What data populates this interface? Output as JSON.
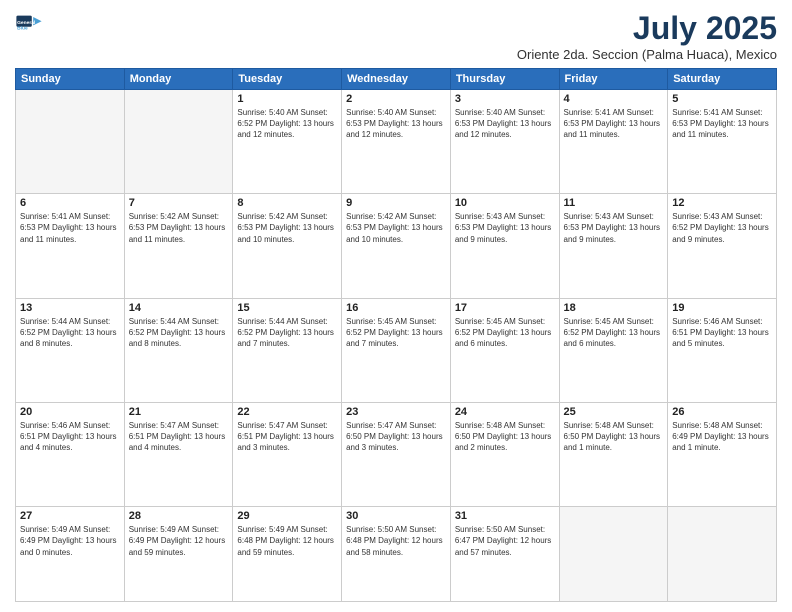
{
  "logo": {
    "line1": "General",
    "line2": "Blue"
  },
  "title": "July 2025",
  "subtitle": "Oriente 2da. Seccion (Palma Huaca), Mexico",
  "days_header": [
    "Sunday",
    "Monday",
    "Tuesday",
    "Wednesday",
    "Thursday",
    "Friday",
    "Saturday"
  ],
  "weeks": [
    [
      {
        "day": "",
        "info": ""
      },
      {
        "day": "",
        "info": ""
      },
      {
        "day": "1",
        "info": "Sunrise: 5:40 AM\nSunset: 6:52 PM\nDaylight: 13 hours\nand 12 minutes."
      },
      {
        "day": "2",
        "info": "Sunrise: 5:40 AM\nSunset: 6:53 PM\nDaylight: 13 hours\nand 12 minutes."
      },
      {
        "day": "3",
        "info": "Sunrise: 5:40 AM\nSunset: 6:53 PM\nDaylight: 13 hours\nand 12 minutes."
      },
      {
        "day": "4",
        "info": "Sunrise: 5:41 AM\nSunset: 6:53 PM\nDaylight: 13 hours\nand 11 minutes."
      },
      {
        "day": "5",
        "info": "Sunrise: 5:41 AM\nSunset: 6:53 PM\nDaylight: 13 hours\nand 11 minutes."
      }
    ],
    [
      {
        "day": "6",
        "info": "Sunrise: 5:41 AM\nSunset: 6:53 PM\nDaylight: 13 hours\nand 11 minutes."
      },
      {
        "day": "7",
        "info": "Sunrise: 5:42 AM\nSunset: 6:53 PM\nDaylight: 13 hours\nand 11 minutes."
      },
      {
        "day": "8",
        "info": "Sunrise: 5:42 AM\nSunset: 6:53 PM\nDaylight: 13 hours\nand 10 minutes."
      },
      {
        "day": "9",
        "info": "Sunrise: 5:42 AM\nSunset: 6:53 PM\nDaylight: 13 hours\nand 10 minutes."
      },
      {
        "day": "10",
        "info": "Sunrise: 5:43 AM\nSunset: 6:53 PM\nDaylight: 13 hours\nand 9 minutes."
      },
      {
        "day": "11",
        "info": "Sunrise: 5:43 AM\nSunset: 6:53 PM\nDaylight: 13 hours\nand 9 minutes."
      },
      {
        "day": "12",
        "info": "Sunrise: 5:43 AM\nSunset: 6:52 PM\nDaylight: 13 hours\nand 9 minutes."
      }
    ],
    [
      {
        "day": "13",
        "info": "Sunrise: 5:44 AM\nSunset: 6:52 PM\nDaylight: 13 hours\nand 8 minutes."
      },
      {
        "day": "14",
        "info": "Sunrise: 5:44 AM\nSunset: 6:52 PM\nDaylight: 13 hours\nand 8 minutes."
      },
      {
        "day": "15",
        "info": "Sunrise: 5:44 AM\nSunset: 6:52 PM\nDaylight: 13 hours\nand 7 minutes."
      },
      {
        "day": "16",
        "info": "Sunrise: 5:45 AM\nSunset: 6:52 PM\nDaylight: 13 hours\nand 7 minutes."
      },
      {
        "day": "17",
        "info": "Sunrise: 5:45 AM\nSunset: 6:52 PM\nDaylight: 13 hours\nand 6 minutes."
      },
      {
        "day": "18",
        "info": "Sunrise: 5:45 AM\nSunset: 6:52 PM\nDaylight: 13 hours\nand 6 minutes."
      },
      {
        "day": "19",
        "info": "Sunrise: 5:46 AM\nSunset: 6:51 PM\nDaylight: 13 hours\nand 5 minutes."
      }
    ],
    [
      {
        "day": "20",
        "info": "Sunrise: 5:46 AM\nSunset: 6:51 PM\nDaylight: 13 hours\nand 4 minutes."
      },
      {
        "day": "21",
        "info": "Sunrise: 5:47 AM\nSunset: 6:51 PM\nDaylight: 13 hours\nand 4 minutes."
      },
      {
        "day": "22",
        "info": "Sunrise: 5:47 AM\nSunset: 6:51 PM\nDaylight: 13 hours\nand 3 minutes."
      },
      {
        "day": "23",
        "info": "Sunrise: 5:47 AM\nSunset: 6:50 PM\nDaylight: 13 hours\nand 3 minutes."
      },
      {
        "day": "24",
        "info": "Sunrise: 5:48 AM\nSunset: 6:50 PM\nDaylight: 13 hours\nand 2 minutes."
      },
      {
        "day": "25",
        "info": "Sunrise: 5:48 AM\nSunset: 6:50 PM\nDaylight: 13 hours\nand 1 minute."
      },
      {
        "day": "26",
        "info": "Sunrise: 5:48 AM\nSunset: 6:49 PM\nDaylight: 13 hours\nand 1 minute."
      }
    ],
    [
      {
        "day": "27",
        "info": "Sunrise: 5:49 AM\nSunset: 6:49 PM\nDaylight: 13 hours\nand 0 minutes."
      },
      {
        "day": "28",
        "info": "Sunrise: 5:49 AM\nSunset: 6:49 PM\nDaylight: 12 hours\nand 59 minutes."
      },
      {
        "day": "29",
        "info": "Sunrise: 5:49 AM\nSunset: 6:48 PM\nDaylight: 12 hours\nand 59 minutes."
      },
      {
        "day": "30",
        "info": "Sunrise: 5:50 AM\nSunset: 6:48 PM\nDaylight: 12 hours\nand 58 minutes."
      },
      {
        "day": "31",
        "info": "Sunrise: 5:50 AM\nSunset: 6:47 PM\nDaylight: 12 hours\nand 57 minutes."
      },
      {
        "day": "",
        "info": ""
      },
      {
        "day": "",
        "info": ""
      }
    ]
  ]
}
